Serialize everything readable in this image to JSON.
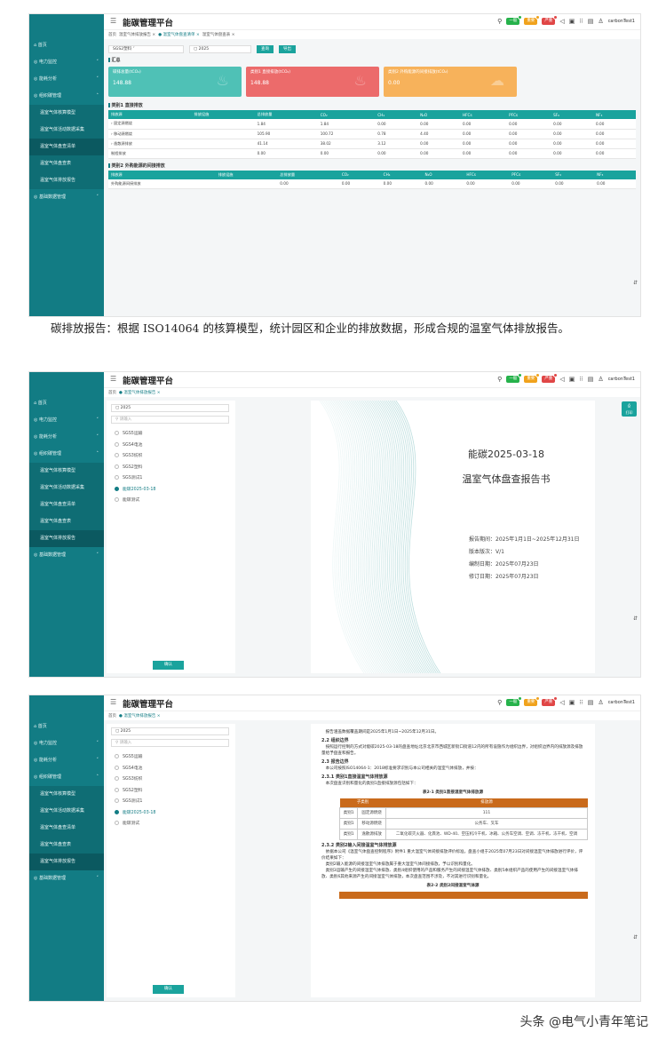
{
  "app": {
    "title": "能碳管理平台",
    "user": "carbonTest1",
    "badges": [
      "一般",
      "重要",
      "严重"
    ]
  },
  "sidebar": [
    {
      "label": "首页",
      "type": "top"
    },
    {
      "label": "电力监控",
      "type": "group",
      "arrow": "˅"
    },
    {
      "label": "能耗分析",
      "type": "group",
      "arrow": "˅"
    },
    {
      "label": "组织碳管理",
      "type": "group",
      "arrow": "˄"
    },
    {
      "label": "温室气体核算模型",
      "type": "sub"
    },
    {
      "label": "温室气体活动数据采集",
      "type": "sub"
    },
    {
      "label": "温室气体盘查清单",
      "type": "sub"
    },
    {
      "label": "温室气体盘查表",
      "type": "sub"
    },
    {
      "label": "温室气体排放报告",
      "type": "sub"
    },
    {
      "label": "基础数据管理",
      "type": "group",
      "arrow": "˅"
    }
  ],
  "s1": {
    "tabs": [
      {
        "label": "首页",
        "cur": false
      },
      {
        "label": "温室气体排放报告 ×",
        "cur": false
      },
      {
        "label": "● 温室气体盘查清单 ×",
        "cur": true
      },
      {
        "label": "温室气体盘查表 ×",
        "cur": false
      }
    ],
    "org": "SGS2塑料",
    "year": "2025",
    "query": "查询",
    "export": "导出",
    "summary_title": "汇总",
    "cards": [
      {
        "label": "碳排总量(tCO₂)",
        "value": "148.88",
        "badge": "148.88"
      },
      {
        "label": "类别1 直接排放(tCO₂)",
        "value": "148.88"
      },
      {
        "label": "类别2 外购能源的间接排放(tCO₂)",
        "value": "0.00"
      }
    ],
    "cat1_title": "类别1 直接排放",
    "cat2_title": "类别2 外购能源的间接排放",
    "headers": [
      "排放源",
      "排放设施",
      "总排放量",
      "CO₂",
      "CH₄",
      "N₂O",
      "HFCs",
      "PFCs",
      "SF₆",
      "NF₃"
    ],
    "cat1_rows": [
      [
        "› 固定源燃烧",
        "",
        "1.84",
        "1.84",
        "0.00",
        "0.00",
        "0.00",
        "0.00",
        "0.00",
        "0.00"
      ],
      [
        "› 移动源燃烧",
        "",
        "105.90",
        "100.72",
        "0.78",
        "4.40",
        "0.00",
        "0.00",
        "0.00",
        "0.00"
      ],
      [
        "› 逸散源排放",
        "",
        "41.14",
        "38.02",
        "3.12",
        "0.00",
        "0.00",
        "0.00",
        "0.00",
        "0.00"
      ],
      [
        "制程排放",
        "",
        "0.00",
        "0.00",
        "0.00",
        "0.00",
        "0.00",
        "0.00",
        "0.00",
        "0.00"
      ]
    ],
    "cat2_rows": [
      [
        "外购能源间接排放",
        "",
        "0.00",
        "0.00",
        "0.00",
        "0.00",
        "0.00",
        "0.00",
        "0.00",
        "0.00"
      ]
    ]
  },
  "caption": "碳排放报告：根据 ISO14064 的核算模型，统计园区和企业的排放数据，形成合规的温室气体排放报告。",
  "s2": {
    "tabs": [
      {
        "label": "首页",
        "cur": false
      },
      {
        "label": "● 温室气体排放报告 ×",
        "cur": true
      }
    ],
    "year": "2025",
    "search_ph": "请输入",
    "orgs": [
      {
        "label": "SGS5运输",
        "sel": false
      },
      {
        "label": "SGS4电池",
        "sel": false
      },
      {
        "label": "SGS3纺织",
        "sel": false
      },
      {
        "label": "SGS2塑料",
        "sel": false
      },
      {
        "label": "SGS测试1",
        "sel": false
      },
      {
        "label": "能碳2025-03-18",
        "sel": true
      },
      {
        "label": "能碳测试",
        "sel": false
      }
    ],
    "confirm": "确认",
    "print": "打印",
    "doc_title1": "能碳2025-03-18",
    "doc_title2": "温室气体盘查报告书",
    "meta": [
      "报告期间：2025年1月1日~2025年12月31日",
      "版本版次：V/1",
      "编制日期：2025年07月23日",
      "修订日期：2025年07月23日"
    ]
  },
  "s3": {
    "tabs": [
      {
        "label": "首页",
        "cur": false
      },
      {
        "label": "● 温室气体排放报告 ×",
        "cur": true
      }
    ],
    "year": "2025",
    "search_ph": "请输入",
    "confirm": "确认",
    "orgs": [
      {
        "label": "SGS5运输",
        "sel": false
      },
      {
        "label": "SGS4电池",
        "sel": false
      },
      {
        "label": "SGS3纺织",
        "sel": false
      },
      {
        "label": "SGS2塑料",
        "sel": false
      },
      {
        "label": "SGS测试1",
        "sel": false
      },
      {
        "label": "能碳2025-03-18",
        "sel": true
      },
      {
        "label": "能碳测试",
        "sel": false
      }
    ],
    "doc": [
      {
        "t": "p",
        "v": "报告涵盖数据覆盖期间是2025年1月1日~2025年12月31日。"
      },
      {
        "t": "h",
        "v": "2.2 组织边界"
      },
      {
        "t": "p",
        "v": "按照运行控制的方式对能碳2025-03-18的盘查地址北京北京市西城区新街口街道12内的所有设施作为组织边界，对组织边界内的排放源及排放量给予盘查和报告。"
      },
      {
        "t": "h",
        "v": "2.3 报告边界"
      },
      {
        "t": "p",
        "v": "本公司按照ISO14064-1：2018标准要求识别与本公司相关的温室气体排放，并按："
      },
      {
        "t": "h",
        "v": "2.3.1 类别1直接温室气体排放源"
      },
      {
        "t": "p",
        "v": "本次盘查识别和量化的类别1直接排放源包括如下："
      },
      {
        "t": "c",
        "v": "表2-1 类别1直接温室气体排放源"
      }
    ],
    "tbl_headers": [
      "子类别",
      "排放源"
    ],
    "tbl_rows": [
      [
        "类别1",
        "固定源燃烧",
        "111"
      ],
      [
        "类别1",
        "移动源燃烧",
        "公务车、叉车"
      ],
      [
        "类别1",
        "逸散源排放",
        "二氧化碳灭火器、化粪池、WD-40、空压机冷干机、冰箱、公务车空调、空调、冻干机、冻干机、空调"
      ]
    ],
    "doc2": [
      {
        "t": "h",
        "v": "2.3.2 类别2输入间接温室气体排放源"
      },
      {
        "t": "p",
        "v": "依据本公司《温室气体盘查控制程序》附件1 重大温室气体间接排放评价标准，盘查小组于2025年07月23日对间接温室气体排放进行评价，评价结果如下："
      },
      {
        "t": "p",
        "v": "类别2输入能源的间接温室气体排放属于重大温室气体间接排放，予以识别和量化。"
      },
      {
        "t": "p",
        "v": "类别3运输产生的间接温室气体排放、类别4组织使用的产品和服务产生的间接温室气体排放、类别5本组织产品的使用产生的间接温室气体排放、类别6其他来源产生的间接温室气体排放，本次盘查范围不涉及，不对其进行识别和量化。"
      },
      {
        "t": "c",
        "v": "表2-2 类别2间接温室气体源"
      }
    ]
  },
  "footer": {
    "watermark": "头条 @电气小青年笔记"
  }
}
